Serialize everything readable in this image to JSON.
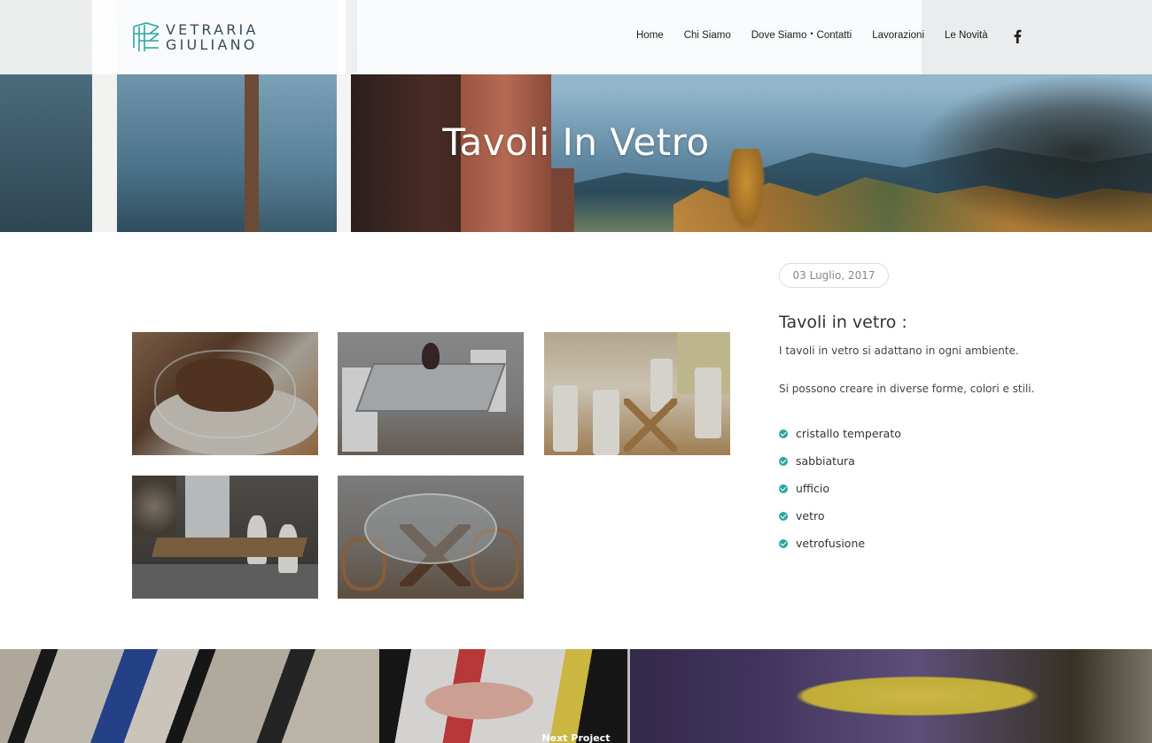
{
  "brand": {
    "line1": "VETRARIA",
    "line2": "GIULIANO",
    "accent_color": "#2aa7a0"
  },
  "nav": {
    "items": [
      {
        "label": "Home"
      },
      {
        "label": "Chi Siamo"
      },
      {
        "label": "Dove Siamo"
      },
      {
        "label": "Contatti"
      },
      {
        "label": "Lavorazioni"
      },
      {
        "label": "Le Novità"
      }
    ],
    "separator": "•",
    "social_icon": "facebook-icon"
  },
  "hero": {
    "title": "Tavoli In Vetro"
  },
  "project": {
    "date": "03 Luglio, 2017",
    "title": "Tavoli in vetro :",
    "paragraph1": "I tavoli in vetro si adattano in ogni ambiente.",
    "paragraph2": "Si possono creare in diverse forme, colori e stili.",
    "tags": [
      {
        "label": "cristallo temperato"
      },
      {
        "label": "sabbiatura"
      },
      {
        "label": "ufficio"
      },
      {
        "label": "vetro"
      },
      {
        "label": "vetrofusione"
      }
    ],
    "tag_icon": "check-circle-icon"
  },
  "footer": {
    "next_label": "Next Project"
  }
}
